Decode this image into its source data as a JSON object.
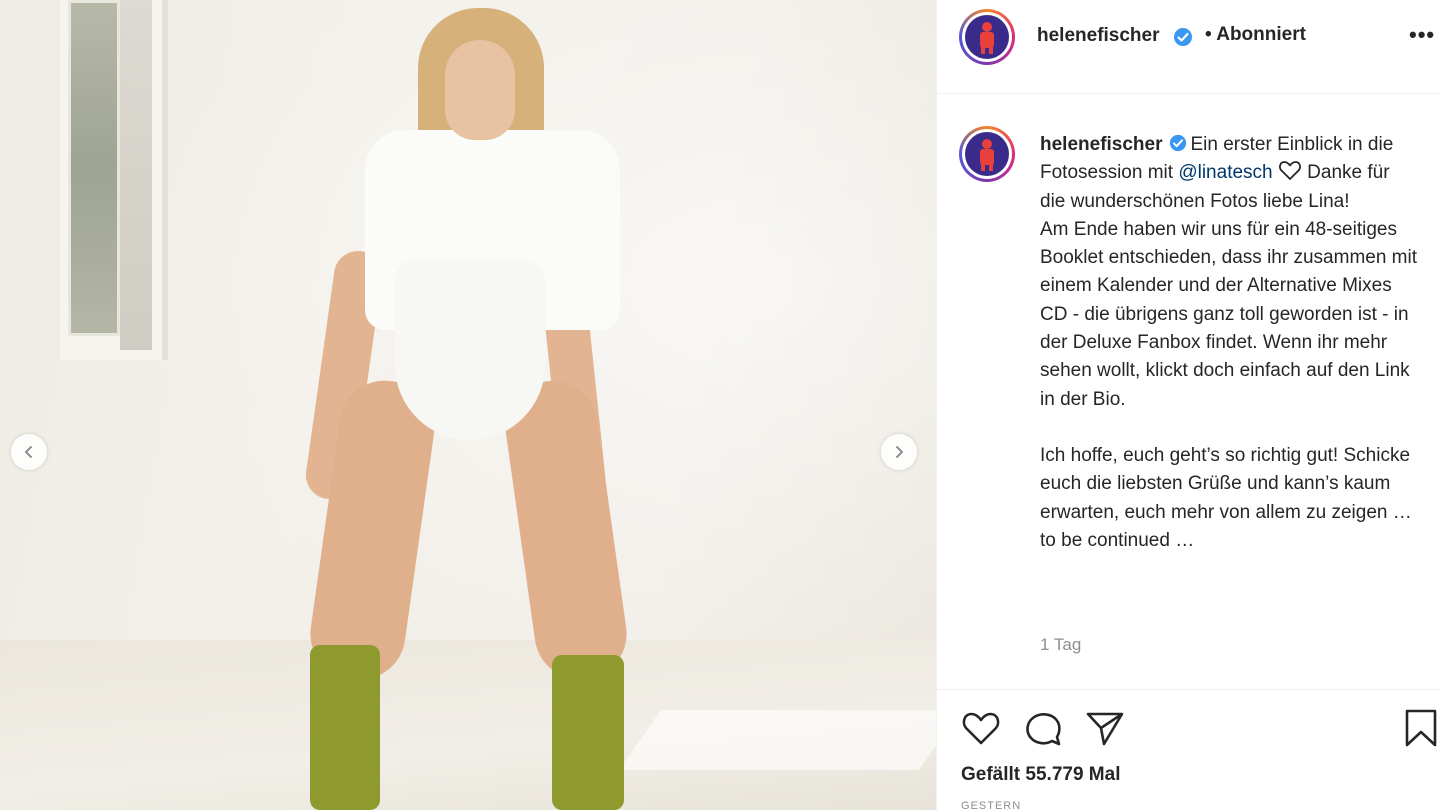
{
  "post": {
    "nav": {
      "prev_icon": "chevron-left-icon",
      "next_icon": "chevron-right-icon"
    }
  },
  "header": {
    "username": "helenefischer",
    "follow_status": "• Abonniert",
    "more_label": "•••"
  },
  "caption": {
    "username": "helenefischer",
    "line1_text": "Ein erster Einblick in die Fotosession mit",
    "mention": "@linatesch",
    "line1_after": "Danke für die wunderschönen Fotos liebe Lina!",
    "paragraph2": "Am Ende haben wir uns für ein 48-seitiges Booklet entschieden, dass ihr zusammen mit einem Kalender und der Alternative Mixes CD - die übrigens ganz toll geworden ist - in der Deluxe Fanbox findet. Wenn ihr mehr sehen wollt, klickt doch einfach auf den Link in der Bio.",
    "paragraph3": "Ich hoffe, euch geht’s so richtig gut! Schicke euch die liebsten Grüße und kann’s kaum erwarten, euch mehr von allem zu zeigen … to be continued …",
    "timestamp": "1 Tag"
  },
  "actions": {
    "likes": "Gefällt 55.779 Mal",
    "date": "GESTERN"
  },
  "colors": {
    "verified": "#3897f0",
    "mention": "#00376b",
    "muted": "#8e8e8e"
  }
}
